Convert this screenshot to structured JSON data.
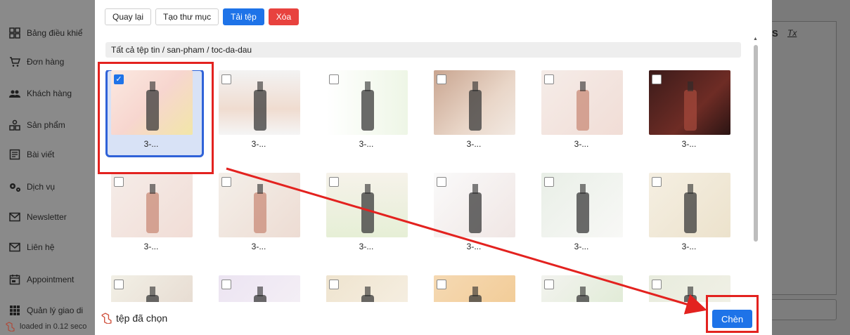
{
  "sidebar": {
    "items": [
      {
        "label": "Bảng điều khiể",
        "icon": "dashboard-icon"
      },
      {
        "label": "Đơn hàng",
        "icon": "cart-icon"
      },
      {
        "label": "Khách hàng",
        "icon": "users-icon"
      },
      {
        "label": "Sản phẩm",
        "icon": "products-icon"
      },
      {
        "label": "Bài viết",
        "icon": "article-icon"
      },
      {
        "label": "Dịch vụ",
        "icon": "services-icon"
      },
      {
        "label": "Newsletter",
        "icon": "mail-icon"
      },
      {
        "label": "Liên hệ",
        "icon": "mail-icon"
      },
      {
        "label": "Appointment",
        "icon": "calendar-icon"
      },
      {
        "label": "Quản lý giao di",
        "icon": "grid-icon"
      }
    ],
    "footer_text": "loaded in 0.12 seco"
  },
  "editor": {
    "tool_strike": "S",
    "tool_clear": "Tx"
  },
  "modal": {
    "toolbar": {
      "back_label": "Quay lại",
      "new_folder_label": "Tạo thư mục",
      "upload_label": "Tải tệp",
      "delete_label": "Xóa"
    },
    "breadcrumb": "Tất cả tệp tin / san-pham / toc-da-dau",
    "files": [
      {
        "caption": "3-...",
        "selected": true,
        "theme": "bottle-lemon"
      },
      {
        "caption": "3-...",
        "selected": false,
        "theme": "hand"
      },
      {
        "caption": "3-...",
        "selected": false,
        "theme": "bottle-text"
      },
      {
        "caption": "3-...",
        "selected": false,
        "theme": "model"
      },
      {
        "caption": "3-...",
        "selected": false,
        "theme": "pink-bottle"
      },
      {
        "caption": "3-...",
        "selected": false,
        "theme": "dark"
      },
      {
        "caption": "3-...",
        "selected": false,
        "theme": "pink-bottle"
      },
      {
        "caption": "3-...",
        "selected": false,
        "theme": "pink-pair"
      },
      {
        "caption": "3-...",
        "selected": false,
        "theme": "herbs"
      },
      {
        "caption": "3-...",
        "selected": false,
        "theme": "white-bottle"
      },
      {
        "caption": "3-...",
        "selected": false,
        "theme": "lab"
      },
      {
        "caption": "3-...",
        "selected": false,
        "theme": "beige"
      },
      {
        "caption": "",
        "selected": false,
        "theme": "face"
      },
      {
        "caption": "",
        "selected": false,
        "theme": "lilac"
      },
      {
        "caption": "",
        "selected": false,
        "theme": "tan"
      },
      {
        "caption": "",
        "selected": false,
        "theme": "orange"
      },
      {
        "caption": "",
        "selected": false,
        "theme": "leaf"
      },
      {
        "caption": "",
        "selected": false,
        "theme": "sage"
      }
    ],
    "footer": {
      "selected_label": "tệp đã chọn",
      "insert_label": "Chèn"
    }
  },
  "colors": {
    "primary": "#1e73e8",
    "danger": "#e8423e",
    "annotation": "#e3221f",
    "selected_frame": "#2f62d8"
  }
}
